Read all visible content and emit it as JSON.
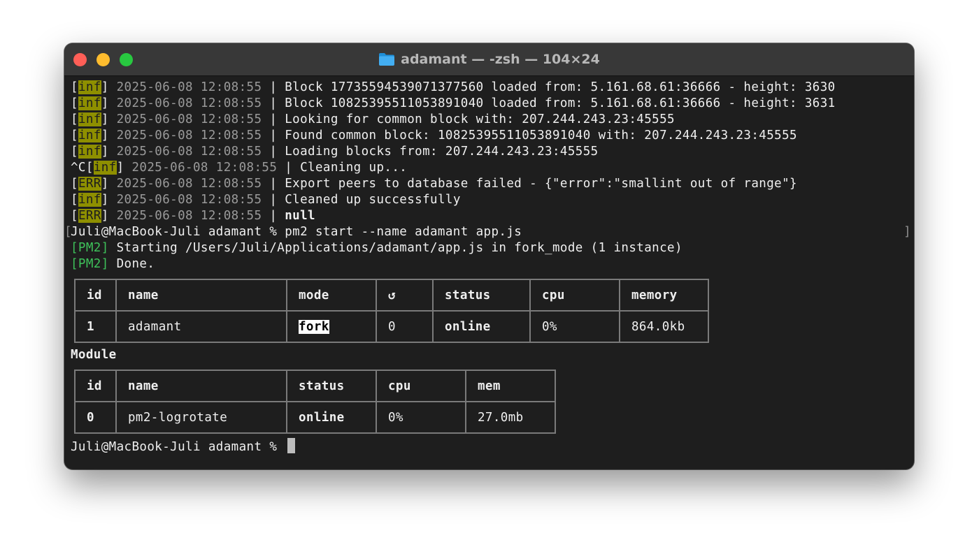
{
  "window": {
    "title": "adamant — -zsh — 104×24",
    "icon": "folder-icon"
  },
  "log_lines": [
    {
      "prefix": "",
      "tag": "inf",
      "timestamp": "2025-06-08 12:08:55",
      "message": "Block 17735594539071377560 loaded from: 5.161.68.61:36666 - height: 3630",
      "bold": false
    },
    {
      "prefix": "",
      "tag": "inf",
      "timestamp": "2025-06-08 12:08:55",
      "message": "Block 10825395511053891040 loaded from: 5.161.68.61:36666 - height: 3631",
      "bold": false
    },
    {
      "prefix": "",
      "tag": "inf",
      "timestamp": "2025-06-08 12:08:55",
      "message": "Looking for common block with: 207.244.243.23:45555",
      "bold": false
    },
    {
      "prefix": "",
      "tag": "inf",
      "timestamp": "2025-06-08 12:08:55",
      "message": "Found common block: 10825395511053891040 with: 207.244.243.23:45555",
      "bold": false
    },
    {
      "prefix": "",
      "tag": "inf",
      "timestamp": "2025-06-08 12:08:55",
      "message": "Loading blocks from: 207.244.243.23:45555",
      "bold": false
    },
    {
      "prefix": "^C",
      "tag": "inf",
      "timestamp": "2025-06-08 12:08:55",
      "message": "Cleaning up...",
      "bold": false
    },
    {
      "prefix": "",
      "tag": "ERR",
      "timestamp": "2025-06-08 12:08:55",
      "message": "Export peers to database failed - {\"error\":\"smallint out of range\"}",
      "bold": false
    },
    {
      "prefix": "",
      "tag": "inf",
      "timestamp": "2025-06-08 12:08:55",
      "message": "Cleaned up successfully",
      "bold": false
    },
    {
      "prefix": "",
      "tag": "ERR",
      "timestamp": "2025-06-08 12:08:55",
      "message": "null",
      "bold": true
    }
  ],
  "command": {
    "prompt": "Juli@MacBook-Juli adamant % ",
    "text": "pm2 start --name adamant app.js"
  },
  "pm2_lines": [
    {
      "tag": "[PM2]",
      "text": "Starting /Users/Juli/Applications/adamant/app.js in fork_mode (1 instance)"
    },
    {
      "tag": "[PM2]",
      "text": "Done."
    }
  ],
  "process_table": {
    "headers": [
      "id",
      "name",
      "mode",
      "↺",
      "status",
      "cpu",
      "memory"
    ],
    "rows": [
      {
        "id": "1",
        "name": "adamant",
        "mode": "fork",
        "restarts": "0",
        "status": "online",
        "cpu": "0%",
        "memory": "864.0kb"
      }
    ]
  },
  "module_heading": "Module",
  "module_table": {
    "headers": [
      "id",
      "name",
      "status",
      "cpu",
      "mem"
    ],
    "rows": [
      {
        "id": "0",
        "name": "pm2-logrotate",
        "status": "online",
        "cpu": "0%",
        "mem": "27.0mb"
      }
    ]
  },
  "final_prompt": "Juli@MacBook-Juli adamant % ",
  "colors": {
    "tag_bg": "#8e8f00",
    "header": "#4dc0d2",
    "online": "#37c848",
    "pm2_tag": "#3ec15a"
  }
}
